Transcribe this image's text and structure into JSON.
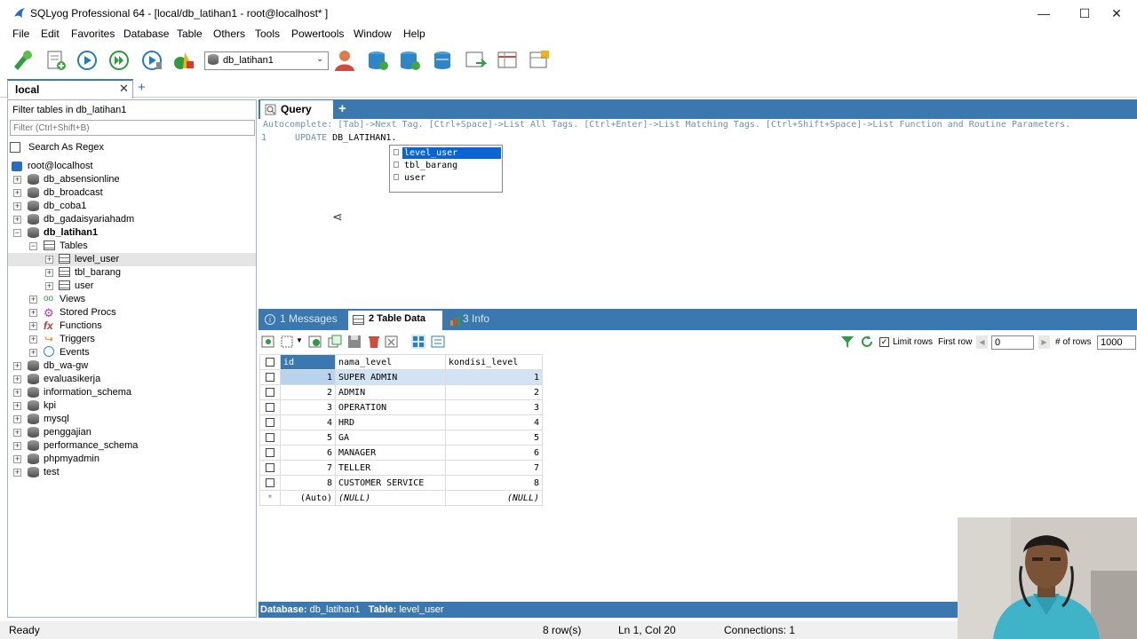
{
  "window": {
    "title": "SQLyog Professional 64 - [local/db_latihan1 - root@localhost* ]"
  },
  "menu": [
    "File",
    "Edit",
    "Favorites",
    "Database",
    "Table",
    "Others",
    "Tools",
    "Powertools",
    "Window",
    "Help"
  ],
  "toolbar": {
    "db_selected": "db_latihan1"
  },
  "connection_tab": {
    "label": "local"
  },
  "left": {
    "filter_label": "Filter tables in db_latihan1",
    "filter_placeholder": "Filter (Ctrl+Shift+B)",
    "regex_label": "Search As Regex",
    "root": "root@localhost",
    "databases_top": [
      "db_absensionline",
      "db_broadcast",
      "db_coba1",
      "db_gadaisyariahadm"
    ],
    "active_db": "db_latihan1",
    "tables_folder": "Tables",
    "tables": [
      "level_user",
      "tbl_barang",
      "user"
    ],
    "folders": [
      "Views",
      "Stored Procs",
      "Functions",
      "Triggers",
      "Events"
    ],
    "databases_bottom": [
      "db_wa-gw",
      "evaluasikerja",
      "information_schema",
      "kpi",
      "mysql",
      "penggajian",
      "performance_schema",
      "phpmyadmin",
      "test"
    ]
  },
  "query": {
    "tab_label": "Query",
    "autocomplete_hint": "Autocomplete: [Tab]->Next Tag. [Ctrl+Space]->List All Tags. [Ctrl+Enter]->List Matching Tags. [Ctrl+Shift+Space]->List Function and Routine Parameters.",
    "line_number": "1",
    "keyword": "UPDATE",
    "code": " DB_LATIHAN1.",
    "suggestions": [
      "level_user",
      "tbl_barang",
      "user"
    ]
  },
  "result_tabs": {
    "messages": "1 Messages",
    "table_data": "2 Table Data",
    "info": "3 Info"
  },
  "result_toolbar": {
    "limit_rows": "Limit rows",
    "first_row_label": "First row",
    "first_row_value": "0",
    "num_rows_label": "# of rows",
    "num_rows_value": "1000"
  },
  "grid": {
    "columns": [
      "id",
      "nama_level",
      "kondisi_level"
    ],
    "rows": [
      [
        "1",
        "SUPER ADMIN",
        "1"
      ],
      [
        "2",
        "ADMIN",
        "2"
      ],
      [
        "3",
        "OPERATION",
        "3"
      ],
      [
        "4",
        "HRD",
        "4"
      ],
      [
        "5",
        "GA",
        "5"
      ],
      [
        "6",
        "MANAGER",
        "6"
      ],
      [
        "7",
        "TELLER",
        "7"
      ],
      [
        "8",
        "CUSTOMER SERVICE",
        "8"
      ]
    ],
    "new_row": [
      "(Auto)",
      "(NULL)",
      "(NULL)"
    ],
    "new_row_marker": "*"
  },
  "status_db": {
    "db_label": "Database:",
    "db_value": "db_latihan1",
    "table_label": "Table:",
    "table_value": "level_user"
  },
  "status": {
    "ready": "Ready",
    "rows": "8 row(s)",
    "position": "Ln 1, Col 20",
    "connections": "Connections: 1"
  },
  "colors": {
    "accent": "#3b78b0",
    "selection": "#0a64d4",
    "keyword": "#6b8fb2"
  }
}
